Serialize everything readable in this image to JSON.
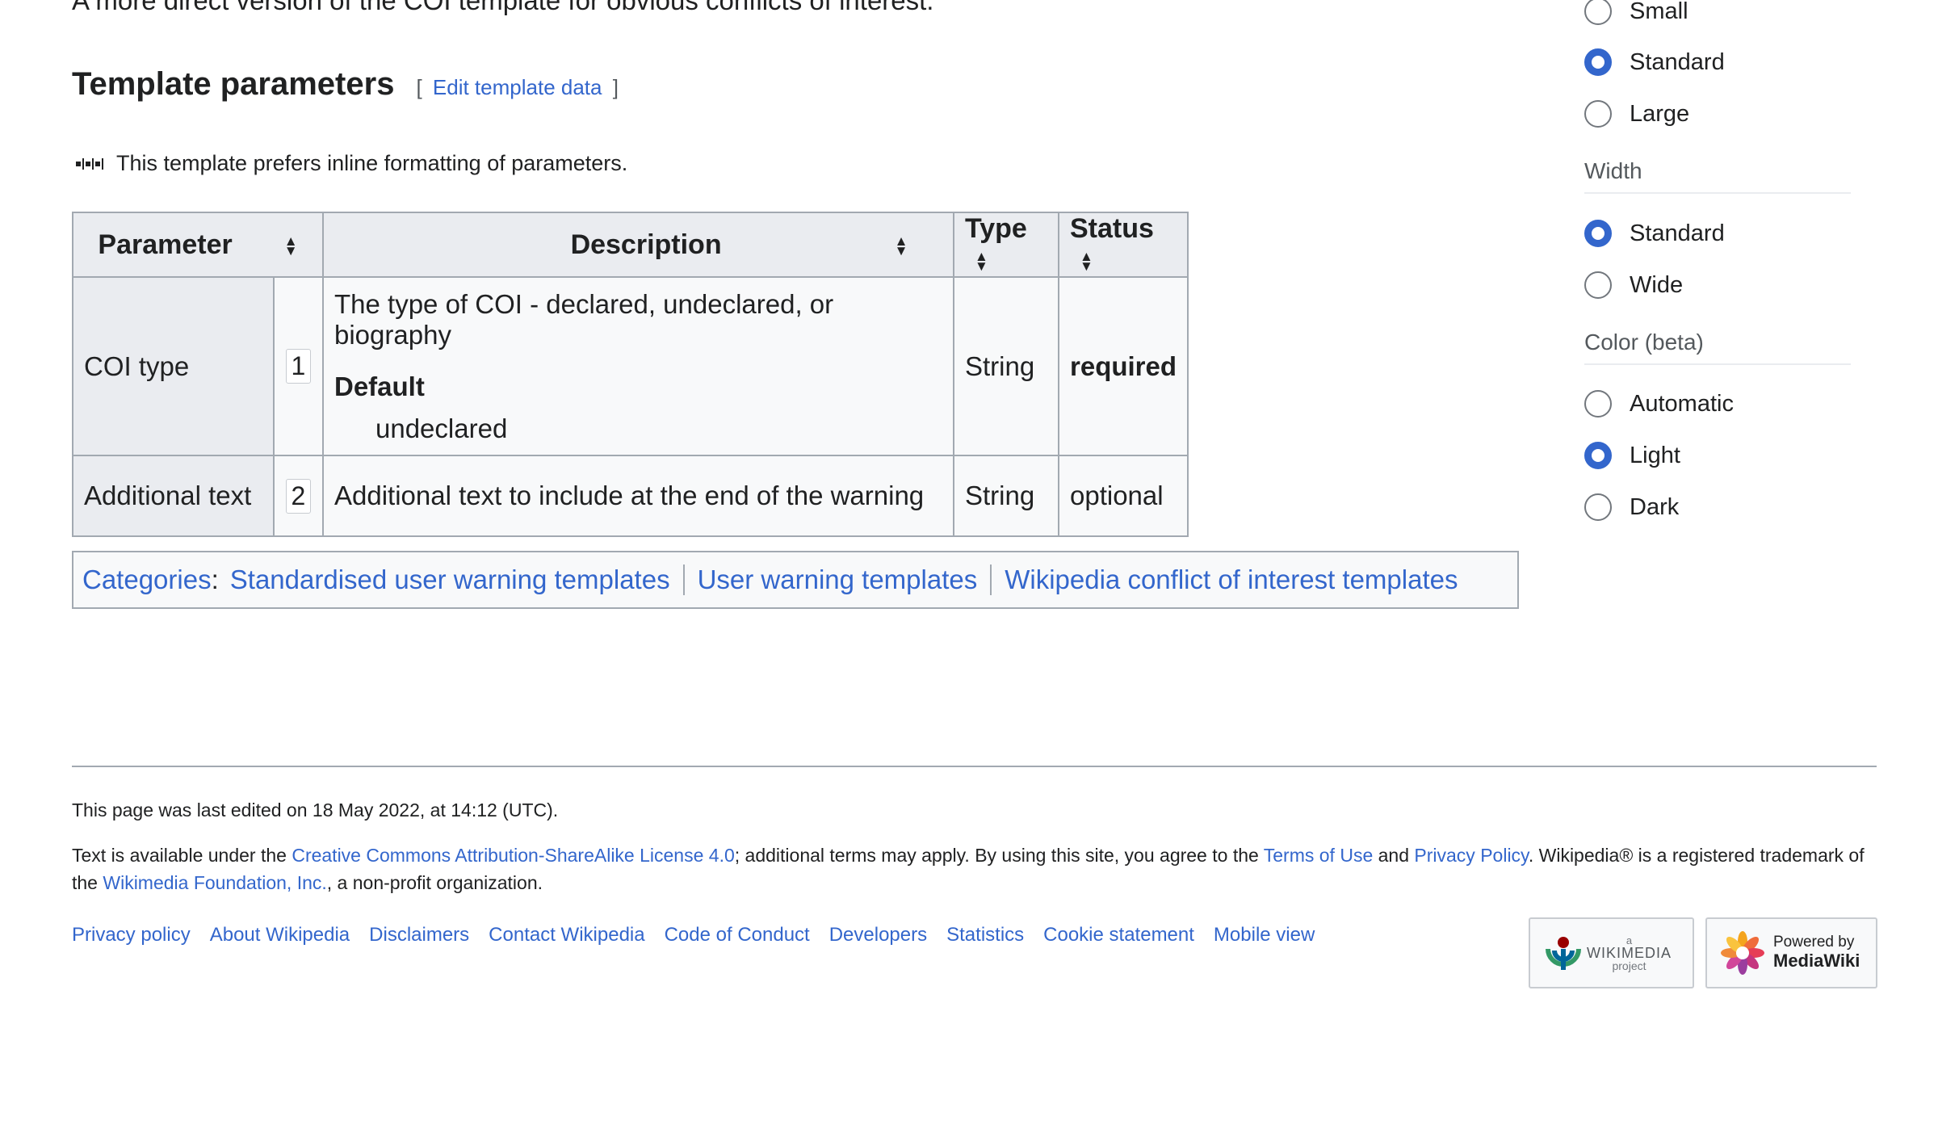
{
  "intro": {
    "text": "A more direct version of the COI template for obvious conflicts of interest."
  },
  "template_params": {
    "heading": "Template parameters",
    "edit_link": "Edit template data",
    "bracket_open": "[",
    "bracket_close": "]",
    "inline_note": "This template prefers inline formatting of parameters.",
    "columns": [
      "Parameter",
      "Description",
      "Type",
      "Status"
    ],
    "rows": [
      {
        "name": "COI type",
        "number": "1",
        "description": "The type of COI - declared, undeclared, or biography",
        "default_label": "Default",
        "default_value": "undeclared",
        "type": "String",
        "status": "required"
      },
      {
        "name": "Additional text",
        "number": "2",
        "description": "Additional text to include at the end of the warning",
        "type": "String",
        "status": "optional"
      }
    ]
  },
  "categories": {
    "label": "Categories",
    "colon": ":",
    "items": [
      "Standardised user warning templates",
      "User warning templates",
      "Wikipedia conflict of interest templates"
    ]
  },
  "sidebar": {
    "text_size_options": [
      {
        "label": "Small",
        "checked": false
      },
      {
        "label": "Standard",
        "checked": true
      },
      {
        "label": "Large",
        "checked": false
      }
    ],
    "width_heading": "Width",
    "width_options": [
      {
        "label": "Standard",
        "checked": true
      },
      {
        "label": "Wide",
        "checked": false
      }
    ],
    "color_heading": "Color (beta)",
    "color_options": [
      {
        "label": "Automatic",
        "checked": false
      },
      {
        "label": "Light",
        "checked": true
      },
      {
        "label": "Dark",
        "checked": false
      }
    ]
  },
  "footer": {
    "last_edited": "This page was last edited on 18 May 2022, at 14:12 (UTC).",
    "license_prefix": "Text is available under the ",
    "license_link": "Creative Commons Attribution-ShareAlike License 4.0",
    "license_mid": "; additional terms may apply. By using this site, you agree to the ",
    "terms_link": "Terms of Use",
    "and": " and ",
    "privacy_link": "Privacy Policy",
    "trademark_text": ". Wikipedia® is a registered trademark of the ",
    "foundation_link": "Wikimedia Foundation, Inc.",
    "nonprofit_text": ", a non-profit organization.",
    "links": [
      "Privacy policy",
      "About Wikipedia",
      "Disclaimers",
      "Contact Wikipedia",
      "Code of Conduct",
      "Developers",
      "Statistics",
      "Cookie statement",
      "Mobile view"
    ],
    "wikimedia_badge": {
      "small": "a",
      "name": "WIKIMEDIA",
      "sub": "project"
    },
    "mediawiki_badge": {
      "line1": "Powered by",
      "line2": "MediaWiki"
    }
  },
  "colors": {
    "link": "#3366cc",
    "radio_checked": "#3366cc",
    "table_header": "#eaecf0",
    "border": "#a2a9b1"
  }
}
